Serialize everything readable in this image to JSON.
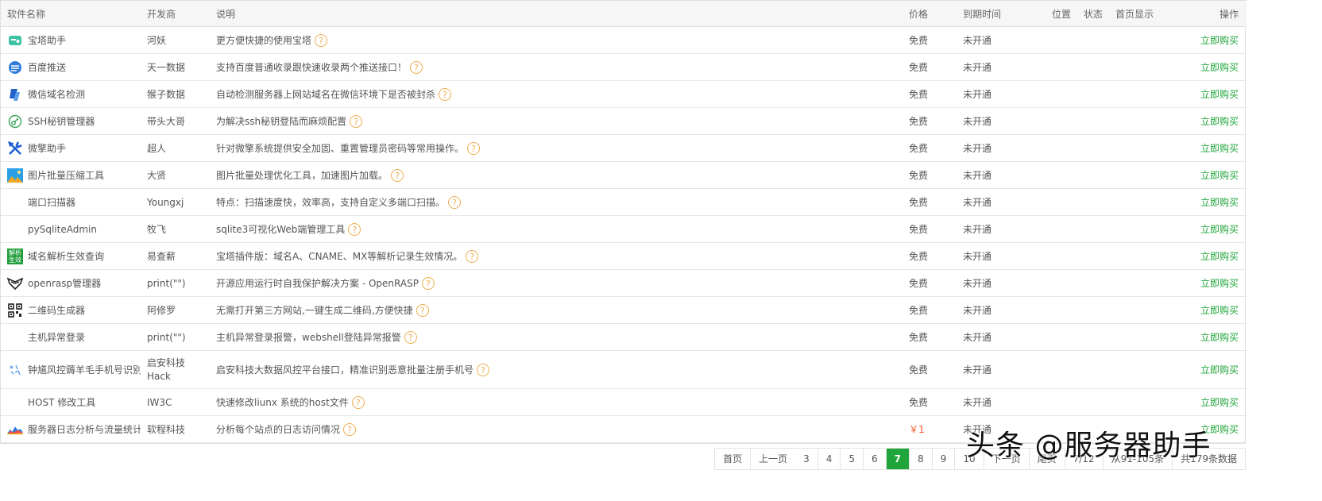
{
  "columns": {
    "name": "软件名称",
    "developer": "开发商",
    "description": "说明",
    "price": "价格",
    "expiry": "到期时间",
    "position": "位置",
    "status": "状态",
    "homepage": "首页显示",
    "action": "操作"
  },
  "help_glyph": "?",
  "rows": [
    {
      "name": "宝塔助手",
      "icon": "bt-helper-icon",
      "developer": "河妖",
      "description": "更方便快捷的使用宝塔",
      "price": "免费",
      "expiry": "未开通",
      "action": "立即购买"
    },
    {
      "name": "百度推送",
      "icon": "baidu-push-icon",
      "developer": "天一数据",
      "description": "支持百度普通收录跟快速收录两个推送接口！",
      "price": "免费",
      "expiry": "未开通",
      "action": "立即购买"
    },
    {
      "name": "微信域名检测",
      "icon": "wechat-check-icon",
      "developer": "猴子数据",
      "description": "自动检测服务器上网站域名在微信环境下是否被封杀",
      "price": "免费",
      "expiry": "未开通",
      "action": "立即购买"
    },
    {
      "name": "SSH秘钥管理器",
      "icon": "key-icon",
      "developer": "带头大哥",
      "description": "为解决ssh秘钥登陆而麻烦配置",
      "price": "免费",
      "expiry": "未开通",
      "action": "立即购买"
    },
    {
      "name": "微擎助手",
      "icon": "tools-icon",
      "developer": "超人",
      "description": "针对微擎系统提供安全加固、重置管理员密码等常用操作。",
      "price": "免费",
      "expiry": "未开通",
      "action": "立即购买"
    },
    {
      "name": "图片批量压缩工具",
      "icon": "image-icon",
      "developer": "大贤",
      "description": "图片批量处理优化工具，加速图片加载。",
      "price": "免费",
      "expiry": "未开通",
      "action": "立即购买"
    },
    {
      "name": "端口扫描器",
      "icon": "",
      "developer": "Youngxj",
      "description": "特点：扫描速度快，效率高，支持自定义多端口扫描。",
      "price": "免费",
      "expiry": "未开通",
      "action": "立即购买"
    },
    {
      "name": "pySqliteAdmin",
      "icon": "",
      "developer": "牧飞",
      "description": "sqlite3可视化Web端管理工具",
      "price": "免费",
      "expiry": "未开通",
      "action": "立即购买"
    },
    {
      "name": "域名解析生效查询",
      "icon": "dns-resolve-icon",
      "icon_text_top": "解析",
      "icon_text_bottom": "生效",
      "developer": "易查薪",
      "description": "宝塔插件版：域名A、CNAME、MX等解析记录生效情况。",
      "price": "免费",
      "expiry": "未开通",
      "action": "立即购买"
    },
    {
      "name": "openrasp管理器",
      "icon": "openrasp-icon",
      "developer": "print(\"\")",
      "description": "开源应用运行时自我保护解决方案 - OpenRASP",
      "price": "免费",
      "expiry": "未开通",
      "action": "立即购买"
    },
    {
      "name": "二维码生成器",
      "icon": "qrcode-icon",
      "developer": "阿修罗",
      "description": "无需打开第三方网站,一键生成二维码,方便快捷",
      "price": "免费",
      "expiry": "未开通",
      "action": "立即购买"
    },
    {
      "name": "主机异常登录",
      "icon": "",
      "developer": "print(\"\")",
      "description": "主机异常登录报警，webshell登陆异常报警",
      "price": "免费",
      "expiry": "未开通",
      "action": "立即购买"
    },
    {
      "name": "钟馗风控薅羊毛手机号识别",
      "icon": "risk-control-icon",
      "developer": "启安科技Hack",
      "developer_wrap": true,
      "description": "启安科技大数据风控平台接口，精准识别恶意批量注册手机号",
      "price": "免费",
      "expiry": "未开通",
      "action": "立即购买"
    },
    {
      "name": "HOST 修改工具",
      "icon": "",
      "developer": "IW3C",
      "description": "快速修改liunx 系统的host文件",
      "price": "免费",
      "expiry": "未开通",
      "action": "立即购买"
    },
    {
      "name": "服务器日志分析与流量统计",
      "icon": "chart-icon",
      "developer": "软程科技",
      "description": "分析每个站点的日志访问情况",
      "price": "￥1",
      "price_highlight": true,
      "expiry": "未开通",
      "action": "立即购买"
    }
  ],
  "pagination": {
    "first": "首页",
    "prev": "上一页",
    "pages": [
      "3",
      "4",
      "5",
      "6",
      "7",
      "8",
      "9",
      "10"
    ],
    "current": "7",
    "next": "下一页",
    "last": "尾页",
    "page_info": "7/12",
    "range_info": "从91-105条",
    "total_info": "共179条数据"
  },
  "watermark": "头条 @服务器助手",
  "colors": {
    "accent": "#20a53a",
    "help": "#f0ad4e",
    "price_paid": "#ff5722"
  }
}
